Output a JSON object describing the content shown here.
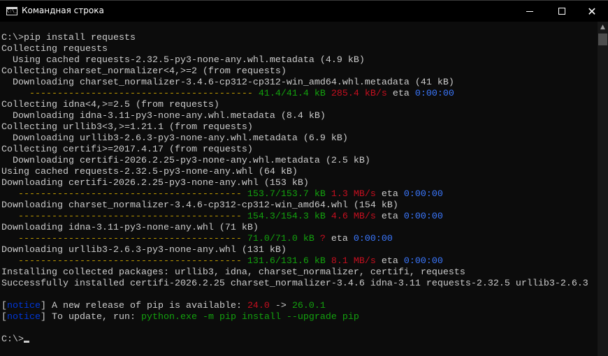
{
  "window": {
    "title": "Командная строка",
    "app_icon_text": "C:\\_",
    "close_glyph": "✕",
    "scroll_up_glyph": "▲"
  },
  "colors": {
    "default": "#cccccc",
    "yellow": "#c19c00",
    "green": "#13a10e",
    "red": "#c50f1f",
    "blue": "#3b78ff",
    "darkblue": "#0037da",
    "bg": "#0c0c0c"
  },
  "lines": [
    [
      [
        "C:\\>pip install requests",
        "default"
      ]
    ],
    [
      [
        "Collecting requests",
        "default"
      ]
    ],
    [
      [
        "  Using cached requests-2.32.5-py3-none-any.whl.metadata (4.9 kB)",
        "default"
      ]
    ],
    [
      [
        "Collecting charset_normalizer<4,>=2 (from requests)",
        "default"
      ]
    ],
    [
      [
        "  Downloading charset_normalizer-3.4.6-cp312-cp312-win_amd64.whl.metadata (41 kB)",
        "default"
      ]
    ],
    [
      [
        "     ---------------------------------------- ",
        "yellow"
      ],
      [
        "41.4/41.4 kB",
        "green"
      ],
      [
        " ",
        "default"
      ],
      [
        "285.4 kB/s",
        "red"
      ],
      [
        " eta ",
        "default"
      ],
      [
        "0:00:00",
        "blue"
      ]
    ],
    [
      [
        "Collecting idna<4,>=2.5 (from requests)",
        "default"
      ]
    ],
    [
      [
        "  Downloading idna-3.11-py3-none-any.whl.metadata (8.4 kB)",
        "default"
      ]
    ],
    [
      [
        "Collecting urllib3<3,>=1.21.1 (from requests)",
        "default"
      ]
    ],
    [
      [
        "  Downloading urllib3-2.6.3-py3-none-any.whl.metadata (6.9 kB)",
        "default"
      ]
    ],
    [
      [
        "Collecting certifi>=2017.4.17 (from requests)",
        "default"
      ]
    ],
    [
      [
        "  Downloading certifi-2026.2.25-py3-none-any.whl.metadata (2.5 kB)",
        "default"
      ]
    ],
    [
      [
        "Using cached requests-2.32.5-py3-none-any.whl (64 kB)",
        "default"
      ]
    ],
    [
      [
        "Downloading certifi-2026.2.25-py3-none-any.whl (153 kB)",
        "default"
      ]
    ],
    [
      [
        "   ---------------------------------------- ",
        "yellow"
      ],
      [
        "153.7/153.7 kB",
        "green"
      ],
      [
        " ",
        "default"
      ],
      [
        "1.3 MB/s",
        "red"
      ],
      [
        " eta ",
        "default"
      ],
      [
        "0:00:00",
        "blue"
      ]
    ],
    [
      [
        "Downloading charset_normalizer-3.4.6-cp312-cp312-win_amd64.whl (154 kB)",
        "default"
      ]
    ],
    [
      [
        "   ---------------------------------------- ",
        "yellow"
      ],
      [
        "154.3/154.3 kB",
        "green"
      ],
      [
        " ",
        "default"
      ],
      [
        "4.6 MB/s",
        "red"
      ],
      [
        " eta ",
        "default"
      ],
      [
        "0:00:00",
        "blue"
      ]
    ],
    [
      [
        "Downloading idna-3.11-py3-none-any.whl (71 kB)",
        "default"
      ]
    ],
    [
      [
        "   ---------------------------------------- ",
        "yellow"
      ],
      [
        "71.0/71.0 kB",
        "green"
      ],
      [
        " ",
        "default"
      ],
      [
        "?",
        "red"
      ],
      [
        " eta ",
        "default"
      ],
      [
        "0:00:00",
        "blue"
      ]
    ],
    [
      [
        "Downloading urllib3-2.6.3-py3-none-any.whl (131 kB)",
        "default"
      ]
    ],
    [
      [
        "   ---------------------------------------- ",
        "yellow"
      ],
      [
        "131.6/131.6 kB",
        "green"
      ],
      [
        " ",
        "default"
      ],
      [
        "8.1 MB/s",
        "red"
      ],
      [
        " eta ",
        "default"
      ],
      [
        "0:00:00",
        "blue"
      ]
    ],
    [
      [
        "Installing collected packages: urllib3, idna, charset_normalizer, certifi, requests",
        "default"
      ]
    ],
    [
      [
        "Successfully installed certifi-2026.2.25 charset_normalizer-3.4.6 idna-3.11 requests-2.32.5 urllib3-2.6.3",
        "default"
      ]
    ],
    [],
    [
      [
        "[",
        "default"
      ],
      [
        "notice",
        "darkblue"
      ],
      [
        "]",
        "default"
      ],
      [
        " A new release of pip is available: ",
        "default"
      ],
      [
        "24.0",
        "red"
      ],
      [
        " -> ",
        "default"
      ],
      [
        "26.0.1",
        "green"
      ]
    ],
    [
      [
        "[",
        "default"
      ],
      [
        "notice",
        "darkblue"
      ],
      [
        "]",
        "default"
      ],
      [
        " To update, run: ",
        "default"
      ],
      [
        "python.exe -m pip install --upgrade pip",
        "green"
      ]
    ],
    [],
    [
      [
        "C:\\>",
        "default"
      ]
    ]
  ]
}
